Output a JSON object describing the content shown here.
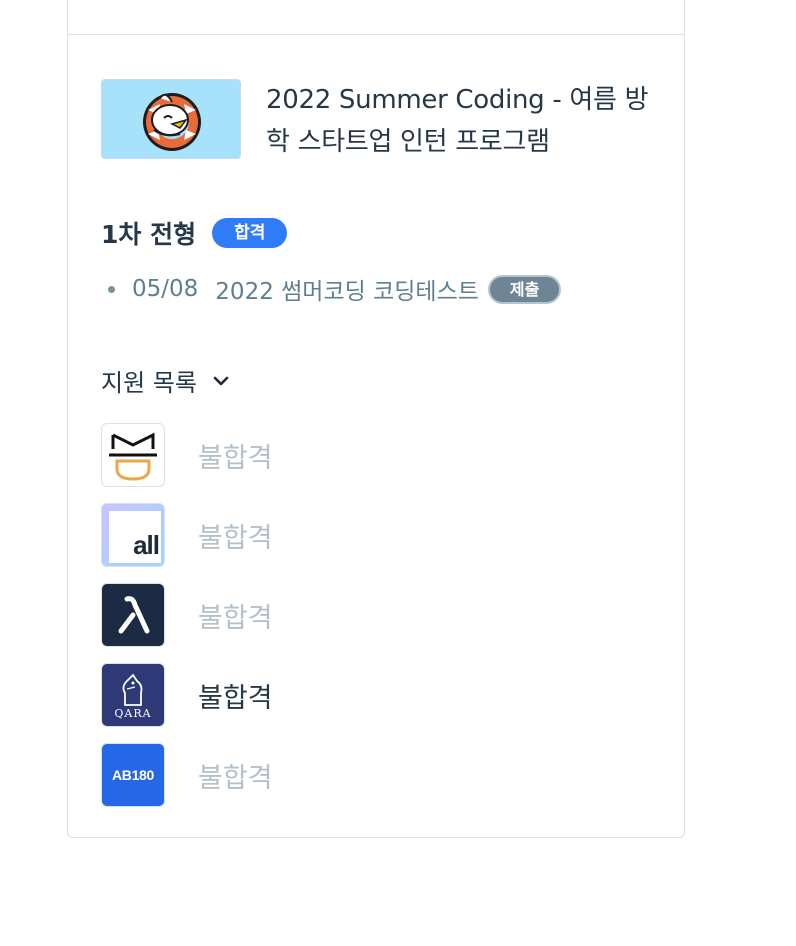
{
  "program": {
    "title": "2022 Summer Coding - 여름 방학 스타트업 인턴 프로그램",
    "thumbnail_icon": "seagull-lifebuoy-mascot"
  },
  "stage": {
    "title": "1차 전형",
    "result_badge": "합격",
    "tests": [
      {
        "date": "05/08",
        "name": "2022 썸머코딩 코딩테스트",
        "status": "제출"
      }
    ]
  },
  "applications": {
    "header": "지원 목록",
    "items": [
      {
        "company_logo": "md-logo",
        "status": "불합격",
        "active": false
      },
      {
        "company_logo": "all-logo",
        "logo_text": "all",
        "status": "불합격",
        "active": false
      },
      {
        "company_logo": "lambda-logo",
        "status": "불합격",
        "active": false
      },
      {
        "company_logo": "qara-logo",
        "logo_text": "QARA",
        "status": "불합격",
        "active": true
      },
      {
        "company_logo": "ab180-logo",
        "logo_text": "AB180",
        "status": "불합격",
        "active": false
      }
    ]
  },
  "colors": {
    "accent": "#2f7cf6",
    "submit_badge": "#6d8595",
    "muted_text": "#b2c0cc",
    "border": "#d7e2eb"
  }
}
